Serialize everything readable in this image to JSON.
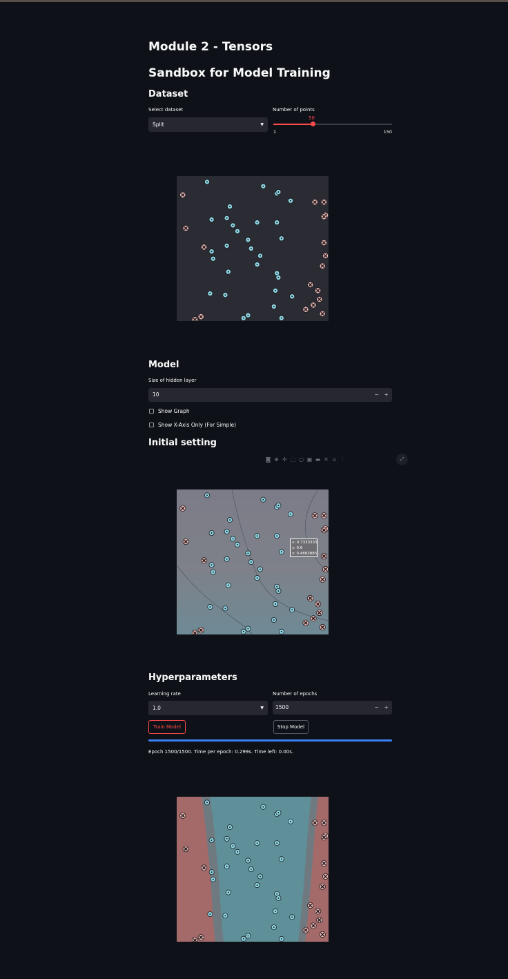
{
  "page": {
    "title": "Module 2 - Tensors",
    "subtitle": "Sandbox for Model Training"
  },
  "dataset": {
    "heading": "Dataset",
    "select_label": "Select dataset",
    "select_value": "Split",
    "points_label": "Number of points",
    "points_value": "50",
    "points_min": "1",
    "points_max": "150",
    "points_fraction": 0.329
  },
  "model": {
    "heading": "Model",
    "hidden_label": "Size of hidden layer",
    "hidden_value": "10",
    "show_graph_label": "Show Graph",
    "show_x_axis_label": "Show X-Axis Only (For Simple)"
  },
  "initial": {
    "heading": "Initial setting",
    "tooltip": {
      "x": "x: 0.7333333",
      "y": "y: 0.6",
      "z": "z: 0.4883885"
    }
  },
  "hyper": {
    "heading": "Hyperparameters",
    "lr_label": "Learning rate",
    "lr_value": "1.0",
    "epochs_label": "Number of epochs",
    "epochs_value": "1500",
    "train_label": "Train Model",
    "stop_label": "Stop Model",
    "progress_fraction": 1.0,
    "status": "Epoch 1500/1500. Time per epoch: 0.299s. Time left: 0.00s."
  },
  "colors": {
    "background": "#0e1117",
    "accent": "#ff4b4b",
    "progress": "#3b82f6",
    "class_x": "#f0b8b8",
    "class_o": "#8ed6e6"
  },
  "points": {
    "x": [
      [
        0.12,
        0.01
      ],
      [
        0.04,
        0.87
      ],
      [
        0.06,
        0.64
      ],
      [
        0.18,
        0.51
      ],
      [
        0.16,
        0.03
      ],
      [
        0.91,
        0.82
      ],
      [
        0.97,
        0.82
      ],
      [
        0.98,
        0.73
      ],
      [
        0.97,
        0.72
      ],
      [
        0.97,
        0.54
      ],
      [
        0.98,
        0.45
      ],
      [
        0.96,
        0.38
      ],
      [
        0.88,
        0.25
      ],
      [
        0.93,
        0.21
      ],
      [
        0.94,
        0.15
      ],
      [
        0.9,
        0.11
      ],
      [
        0.85,
        0.08
      ],
      [
        0.96,
        0.05
      ]
    ],
    "o": [
      [
        0.2,
        0.96
      ],
      [
        0.57,
        0.93
      ],
      [
        0.66,
        0.88
      ],
      [
        0.67,
        0.89
      ],
      [
        0.75,
        0.83
      ],
      [
        0.35,
        0.79
      ],
      [
        0.23,
        0.7
      ],
      [
        0.33,
        0.71
      ],
      [
        0.37,
        0.66
      ],
      [
        0.4,
        0.62
      ],
      [
        0.53,
        0.68
      ],
      [
        0.66,
        0.68
      ],
      [
        0.69,
        0.57
      ],
      [
        0.47,
        0.56
      ],
      [
        0.33,
        0.52
      ],
      [
        0.23,
        0.48
      ],
      [
        0.24,
        0.43
      ],
      [
        0.49,
        0.5
      ],
      [
        0.55,
        0.45
      ],
      [
        0.53,
        0.39
      ],
      [
        0.34,
        0.34
      ],
      [
        0.66,
        0.33
      ],
      [
        0.67,
        0.3
      ],
      [
        0.22,
        0.19
      ],
      [
        0.32,
        0.18
      ],
      [
        0.65,
        0.21
      ],
      [
        0.76,
        0.17
      ],
      [
        0.64,
        0.1
      ],
      [
        0.47,
        0.04
      ],
      [
        0.44,
        0.02
      ],
      [
        0.69,
        0.02
      ]
    ]
  }
}
